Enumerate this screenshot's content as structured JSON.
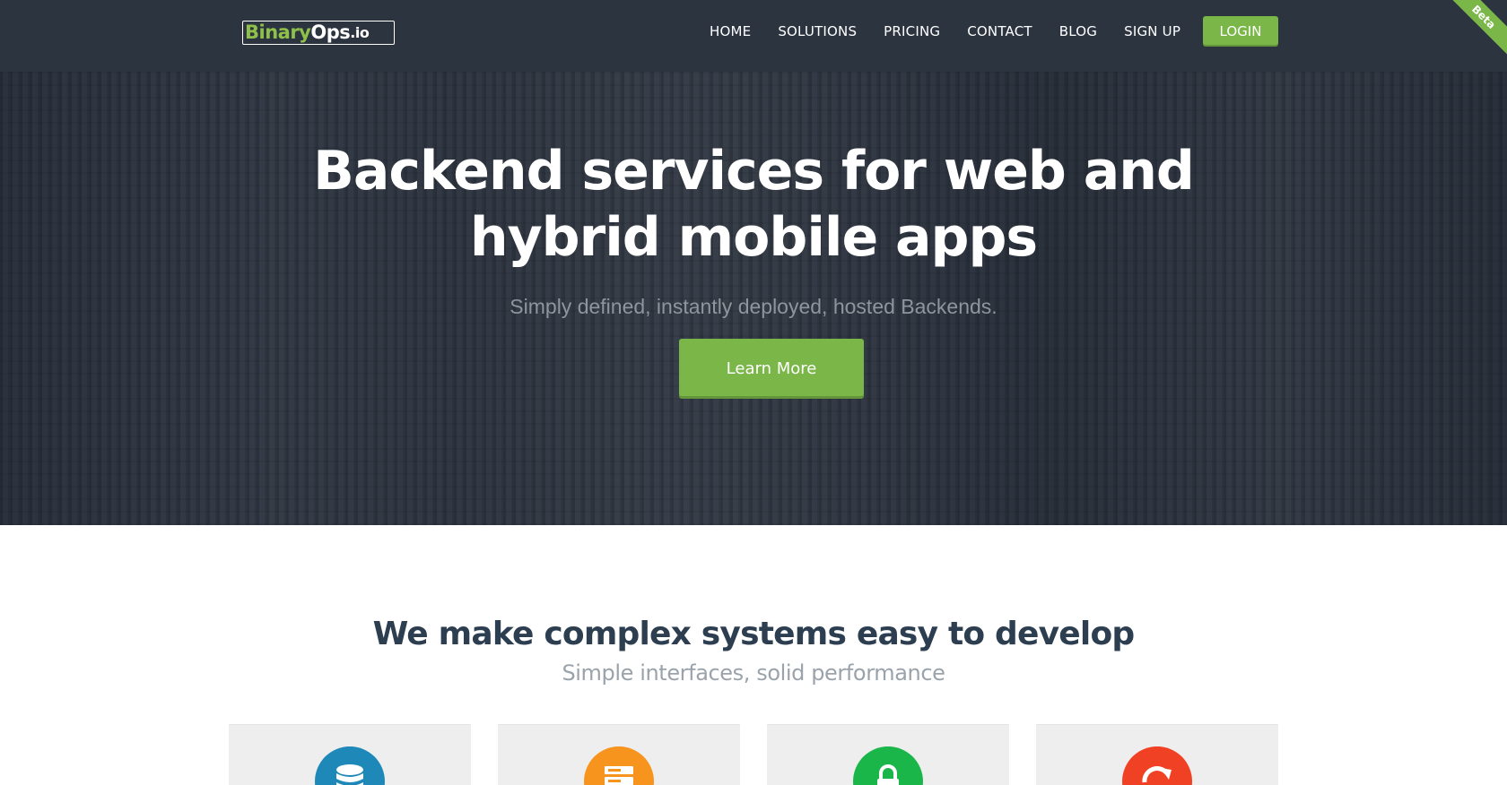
{
  "brand": {
    "part1": "Binary",
    "part2": "Ops",
    "part3": ".io",
    "accent": "#8fc14a"
  },
  "nav": {
    "items": [
      "HOME",
      "SOLUTIONS",
      "PRICING",
      "CONTACT",
      "BLOG",
      "SIGN UP"
    ],
    "login": "LOGIN"
  },
  "ribbon": "Beta",
  "hero": {
    "title": "Backend services for web and hybrid mobile apps",
    "subtitle": "Simply defined, instantly deployed, hosted Backends.",
    "cta": "Learn More"
  },
  "features": {
    "title": "We make complex systems easy to develop",
    "subtitle": "Simple interfaces, solid performance",
    "cards": [
      {
        "icon": "database-icon",
        "color": "#1e88b8"
      },
      {
        "icon": "server-icon",
        "color": "#f7941d"
      },
      {
        "icon": "lock-icon",
        "color": "#1ab64a"
      },
      {
        "icon": "refresh-icon",
        "color": "#f04124"
      }
    ]
  },
  "colors": {
    "navbar": "#2c3440",
    "accent": "#7ab648",
    "heading": "#2c3e50"
  }
}
